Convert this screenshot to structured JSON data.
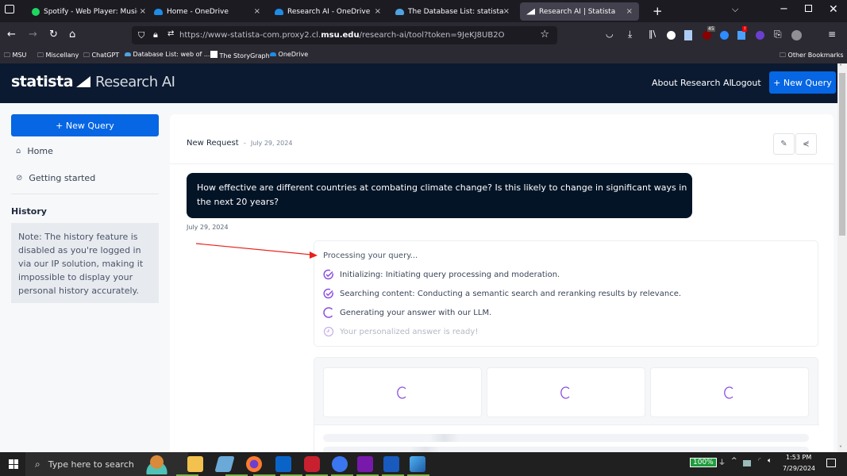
{
  "browser": {
    "tabs": [
      {
        "label": "Spotify - Web Player: Music for...",
        "icon": "spotify-icon",
        "color": "#1ed760"
      },
      {
        "label": "Home - OneDrive",
        "icon": "onedrive-icon",
        "color": "#1f8ce6"
      },
      {
        "label": "Research AI - OneDrive",
        "icon": "onedrive-icon",
        "color": "#1f8ce6"
      },
      {
        "label": "The Database List: statista",
        "icon": "onedrive-icon",
        "color": "#4fa3e0"
      },
      {
        "label": "Research AI | Statista",
        "icon": "statista-icon",
        "color": "#ffffff",
        "active": true
      }
    ],
    "close_glyph": "×",
    "new_tab_glyph": "+",
    "url_host_prefix": "https://www-statista-com.proxy2.cl.",
    "url_host_bold": "msu.edu",
    "url_path": "/research-ai/tool?token=9JeKJ8UB2O",
    "bookmarks": [
      {
        "label": "MSU",
        "icon": "folder-icon"
      },
      {
        "label": "Miscellany",
        "icon": "folder-icon"
      },
      {
        "label": "ChatGPT",
        "icon": "folder-icon"
      },
      {
        "label": "Database List: web of ...",
        "icon": "onedrive-icon"
      },
      {
        "label": "The StoryGraph",
        "icon": "storygraph-icon"
      },
      {
        "label": "OneDrive",
        "icon": "onedrive-icon"
      }
    ],
    "other_bookmarks": "Other Bookmarks",
    "ext_badges": {
      "ublock": "45",
      "alert": "!"
    }
  },
  "header": {
    "brand": "statista",
    "product": "Research AI",
    "links": [
      "About Research AI",
      "Logout"
    ],
    "new_query": "+ New Query"
  },
  "sidebar": {
    "new_query": "+ New Query",
    "items": [
      {
        "label": "Home",
        "icon": "home-icon"
      },
      {
        "label": "Getting started",
        "icon": "compass-icon"
      }
    ],
    "history_title": "History",
    "history_note": "Note: The history feature is disabled as you're logged in via our IP solution, making it impossible to display your personal history accurately."
  },
  "main": {
    "request_title": "New Request",
    "separator": "-",
    "request_date": "July 29, 2024",
    "question": "How effective are different countries at combating climate change? Is this likely to change in significant ways in the next 20 years?",
    "question_date": "July 29, 2024",
    "processing_title": "Processing your query...",
    "steps": [
      {
        "label": "Initializing: Initiating query processing and moderation.",
        "status": "done"
      },
      {
        "label": "Searching content: Conducting a semantic search and reranking results by relevance.",
        "status": "done"
      },
      {
        "label": "Generating your answer with our LLM.",
        "status": "loading"
      },
      {
        "label": "Your personalized answer is ready!",
        "status": "pending"
      }
    ],
    "accent": "#8b4fe0"
  },
  "taskbar": {
    "search_placeholder": "Type here to search",
    "battery": "100%",
    "time": "1:53 PM",
    "date": "7/29/2024"
  }
}
